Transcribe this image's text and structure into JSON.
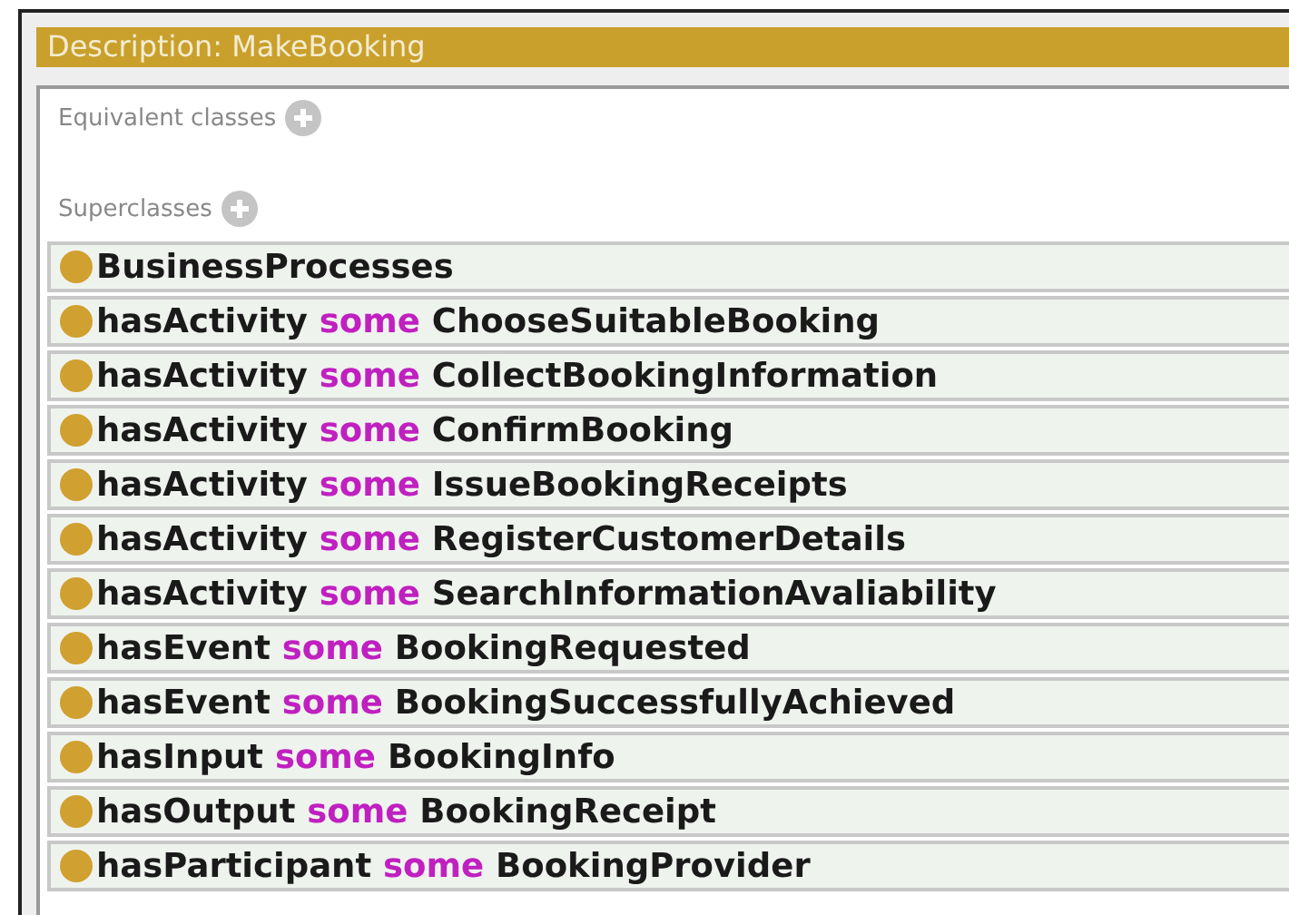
{
  "window": {
    "title": "Description: MakeBooking"
  },
  "sections": [
    {
      "label": "Equivalent classes"
    },
    {
      "label": "Superclasses"
    }
  ],
  "superclasses": [
    {
      "kind": "class",
      "filler": "BusinessProcesses"
    },
    {
      "kind": "restriction",
      "property": "hasActivity",
      "keyword": "some",
      "filler": "ChooseSuitableBooking"
    },
    {
      "kind": "restriction",
      "property": "hasActivity",
      "keyword": "some",
      "filler": "CollectBookingInformation"
    },
    {
      "kind": "restriction",
      "property": "hasActivity",
      "keyword": "some",
      "filler": "ConfirmBooking"
    },
    {
      "kind": "restriction",
      "property": "hasActivity",
      "keyword": "some",
      "filler": "IssueBookingReceipts"
    },
    {
      "kind": "restriction",
      "property": "hasActivity",
      "keyword": "some",
      "filler": "RegisterCustomerDetails"
    },
    {
      "kind": "restriction",
      "property": "hasActivity",
      "keyword": "some",
      "filler": "SearchInformationAvaliability"
    },
    {
      "kind": "restriction",
      "property": "hasEvent",
      "keyword": "some",
      "filler": "BookingRequested"
    },
    {
      "kind": "restriction",
      "property": "hasEvent",
      "keyword": "some",
      "filler": "BookingSuccessfullyAchieved"
    },
    {
      "kind": "restriction",
      "property": "hasInput",
      "keyword": "some",
      "filler": "BookingInfo"
    },
    {
      "kind": "restriction",
      "property": "hasOutput",
      "keyword": "some",
      "filler": "BookingReceipt"
    },
    {
      "kind": "restriction",
      "property": "hasParticipant",
      "keyword": "some",
      "filler": "BookingProvider"
    }
  ]
}
